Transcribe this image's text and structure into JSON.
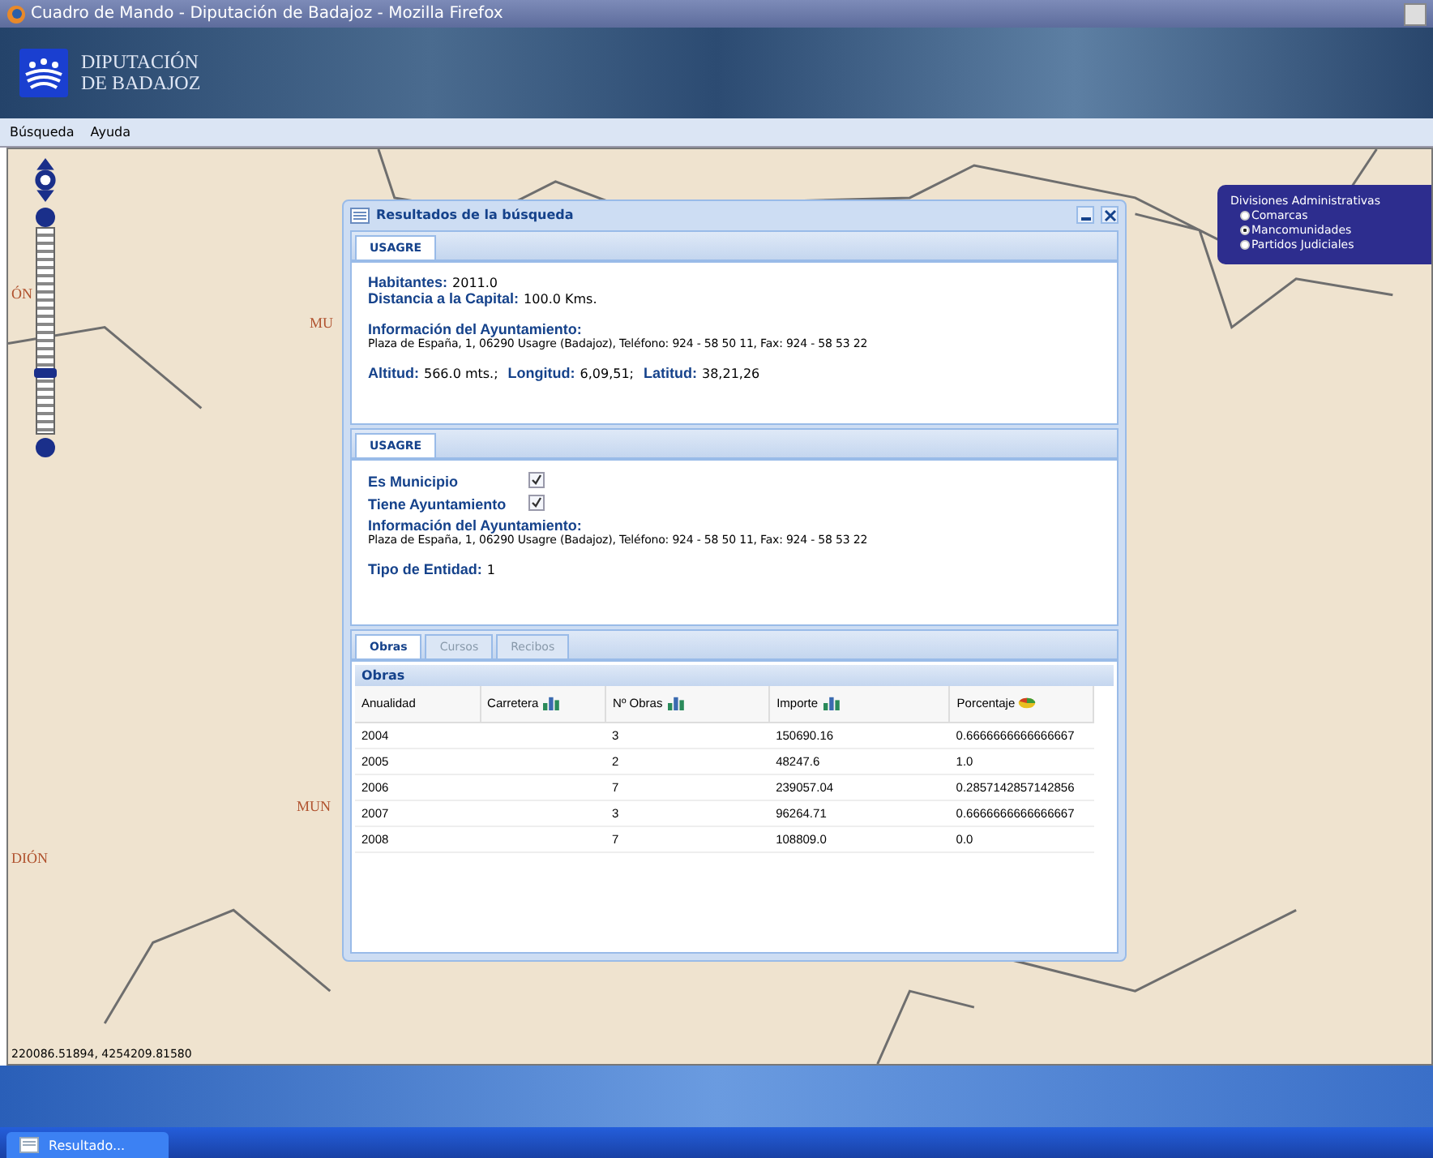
{
  "window": {
    "title": "Cuadro de Mando - Diputación de Badajoz - Mozilla Firefox"
  },
  "header": {
    "logo_lines": [
      "DIPUTACIÓN",
      "DE BADAJOZ"
    ]
  },
  "menu": [
    {
      "label": "Búsqueda"
    },
    {
      "label": "Ayuda"
    }
  ],
  "map": {
    "zoom_slider": {
      "level": 0.27
    },
    "labels": [
      {
        "text": "ÓN"
      },
      {
        "text": "MU"
      },
      {
        "text": "MUN"
      },
      {
        "text": "DIÓN"
      }
    ],
    "coordinates": "220086.51894, 4254209.81580"
  },
  "layers": {
    "title": "Divisiones Administrativas",
    "options": [
      {
        "label": "Comarcas",
        "selected": false
      },
      {
        "label": "Mancomunidades",
        "selected": true
      },
      {
        "label": "Partidos Judiciales",
        "selected": false
      }
    ]
  },
  "dialog": {
    "title": "Resultados de la búsqueda",
    "panel1": {
      "tab": {
        "label": "USAGRE",
        "selected": true
      },
      "lines": [
        {
          "label": "Habitantes:",
          "value": "2011.0"
        },
        {
          "label": "Distancia a la Capital:",
          "value": "100.0 Kms."
        }
      ],
      "info_label": "Información del Ayuntamiento:",
      "info_text": "Plaza de España, 1, 06290 Usagre (Badajoz), Teléfono: 924 - 58 50 11, Fax: 924 - 58 53 22",
      "geo": [
        {
          "label": "Altitud:",
          "value": "566.0 mts.;"
        },
        {
          "label": "Longitud:",
          "value": "6,09,51;"
        },
        {
          "label": "Latitud:",
          "value": "38,21,26"
        }
      ]
    },
    "panel2": {
      "tab": {
        "label": "USAGRE",
        "selected": true
      },
      "checks": [
        {
          "label": "Es Municipio",
          "checked": true
        },
        {
          "label": "Tiene Ayuntamiento",
          "checked": true
        }
      ],
      "info_label": "Información del Ayuntamiento:",
      "info_text": "Plaza de España, 1, 06290 Usagre (Badajoz), Teléfono: 924 - 58 50 11, Fax: 924 - 58 53 22",
      "tipo": {
        "label": "Tipo de Entidad:",
        "value": "1"
      }
    },
    "tabs": [
      {
        "label": "Obras",
        "selected": true
      },
      {
        "label": "Cursos",
        "selected": false
      },
      {
        "label": "Recibos",
        "selected": false
      }
    ],
    "grid_title": "Obras",
    "table": {
      "columns": [
        {
          "label": "Anualidad",
          "kind": "plain"
        },
        {
          "label": "Carretera",
          "kind": "bar-chart"
        },
        {
          "label": "Nº Obras",
          "kind": "bar-chart"
        },
        {
          "label": "Importe",
          "kind": "bar-chart"
        },
        {
          "label": "Porcentaje",
          "kind": "pie-chart"
        }
      ],
      "rows": [
        [
          "2004",
          "",
          "3",
          "150690.16",
          "0.6666666666666667"
        ],
        [
          "2005",
          "",
          "2",
          "48247.6",
          "1.0"
        ],
        [
          "2006",
          "",
          "7",
          "239057.04",
          "0.2857142857142856"
        ],
        [
          "2007",
          "",
          "3",
          "96264.71",
          "0.6666666666666667"
        ],
        [
          "2008",
          "",
          "7",
          "108809.0",
          "0.0"
        ]
      ]
    }
  },
  "taskbar": {
    "items": [
      {
        "label": "Resultado..."
      }
    ]
  }
}
